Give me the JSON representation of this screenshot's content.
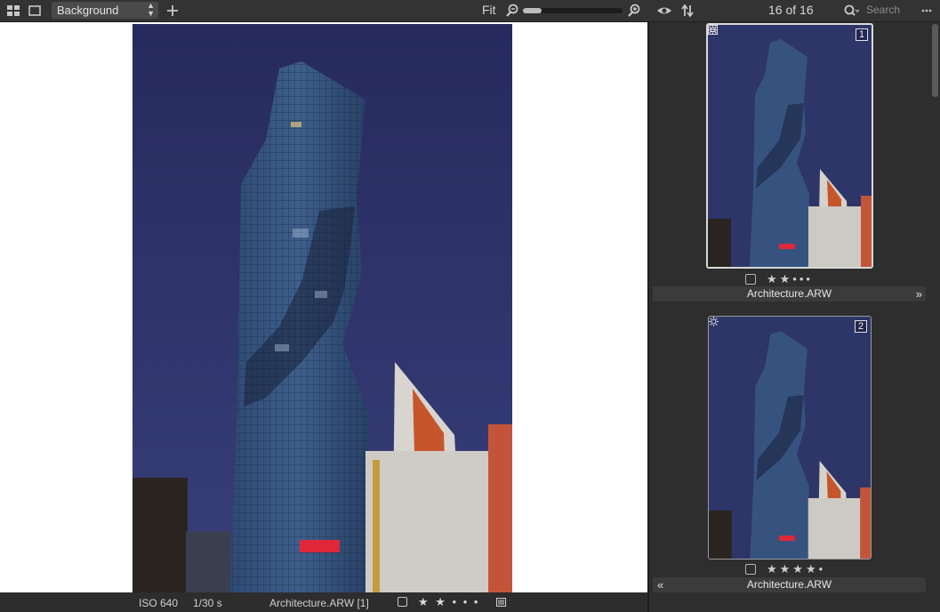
{
  "toolbar": {
    "layer_select_value": "Background",
    "zoom_label": "Fit",
    "zoom_level": 0.1,
    "counter": "16 of 16",
    "search_placeholder": "Search"
  },
  "viewer": {
    "iso": "ISO 640",
    "shutter": "1/30 s",
    "filename": "Architecture.ARW [1]",
    "rating": "★ ★ • • •"
  },
  "browser": {
    "items": [
      {
        "number": "1",
        "rating": "★★•••",
        "filename": "Architecture.ARW",
        "nav": "»"
      },
      {
        "number": "2",
        "rating": "★★★★•",
        "filename": "Architecture.ARW",
        "nav": "«"
      }
    ]
  },
  "colors": {
    "toolbar_bg": "#333333",
    "viewer_bg": "#ffffff",
    "browser_bg": "#2e2e2e",
    "sky": "#2b3467",
    "building": "#3a5680"
  }
}
